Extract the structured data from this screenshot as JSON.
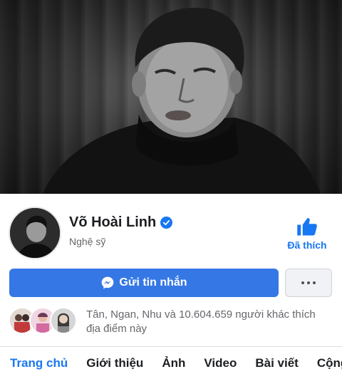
{
  "page": {
    "name": "Võ Hoài Linh",
    "category": "Nghệ sỹ",
    "verified": true
  },
  "actions": {
    "like_label": "Đã thích",
    "message_label": "Gửi tin nhắn",
    "more_icon": "more-horizontal-icon"
  },
  "social": {
    "likes_line1": "Tân, Ngan, Nhu và 10.604.659 người khác thích",
    "likes_line2": "địa điểm này"
  },
  "tabs": [
    {
      "label": "Trang chủ",
      "active": true
    },
    {
      "label": "Giới thiệu",
      "active": false
    },
    {
      "label": "Ảnh",
      "active": false
    },
    {
      "label": "Video",
      "active": false
    },
    {
      "label": "Bài viết",
      "active": false
    },
    {
      "label": "Cộng",
      "active": false
    }
  ],
  "colors": {
    "accent": "#1877f2",
    "button": "#3578e5",
    "secondary_text": "#65676b"
  }
}
